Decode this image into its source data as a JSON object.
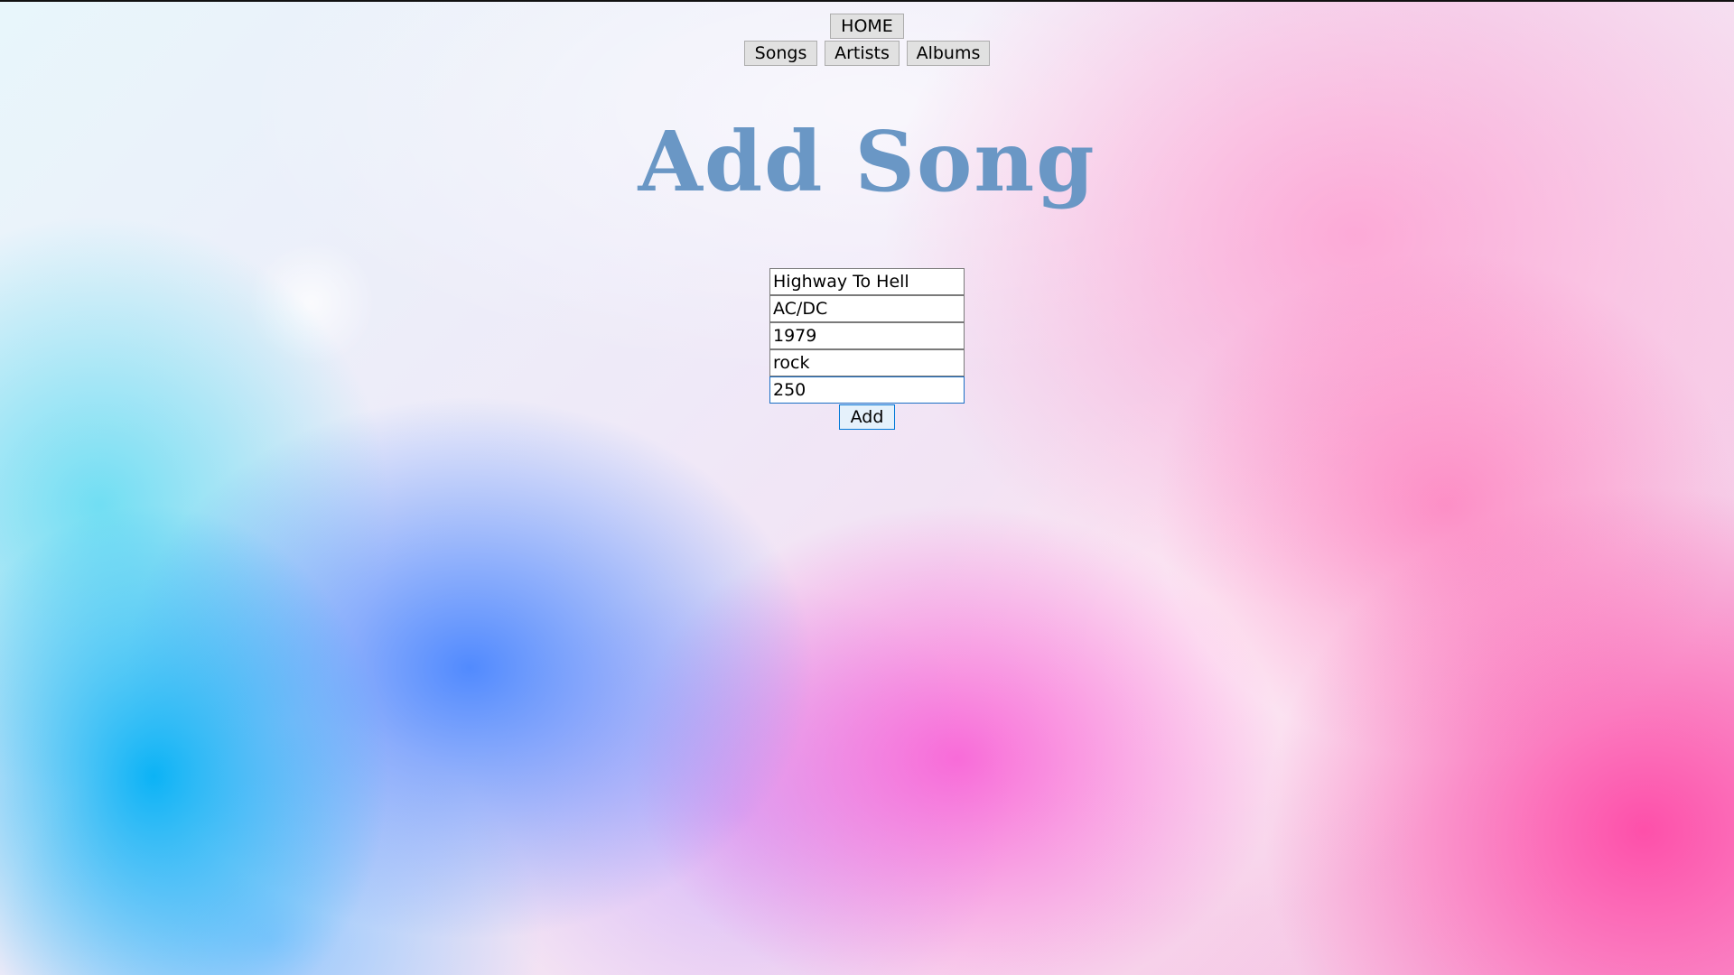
{
  "nav": {
    "home_label": "HOME",
    "songs_label": "Songs",
    "artists_label": "Artists",
    "albums_label": "Albums"
  },
  "page": {
    "title": "Add Song"
  },
  "form": {
    "fields": [
      {
        "value": "Highway To Hell"
      },
      {
        "value": "AC/DC"
      },
      {
        "value": "1979"
      },
      {
        "value": "rock"
      },
      {
        "value": "250"
      }
    ],
    "add_label": "Add"
  },
  "colors": {
    "title": "#6a97c5",
    "focus_border": "#1a6ec4",
    "button_bg": "#e1e1e1"
  }
}
